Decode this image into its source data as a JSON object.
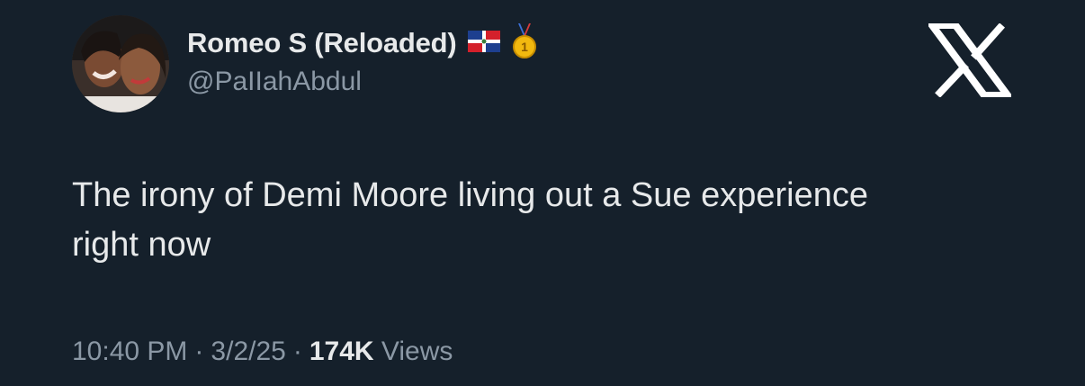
{
  "author": {
    "display_name": "Romeo S (Reloaded)",
    "handle": "@PaIIahAbdul",
    "badges": [
      "dominican-flag-icon",
      "first-place-medal-icon"
    ]
  },
  "brand": {
    "logo": "x-logo-icon"
  },
  "tweet": {
    "text_line1": "The irony of Demi Moore living out a Sue experience",
    "text_line2": "right now"
  },
  "meta": {
    "time": "10:40 PM",
    "separator": "·",
    "date": "3/2/25",
    "views_count": "174K",
    "views_label": "Views"
  },
  "colors": {
    "background": "#15202b",
    "primary_text": "#e7e9ea",
    "secondary_text": "#8b98a5"
  }
}
